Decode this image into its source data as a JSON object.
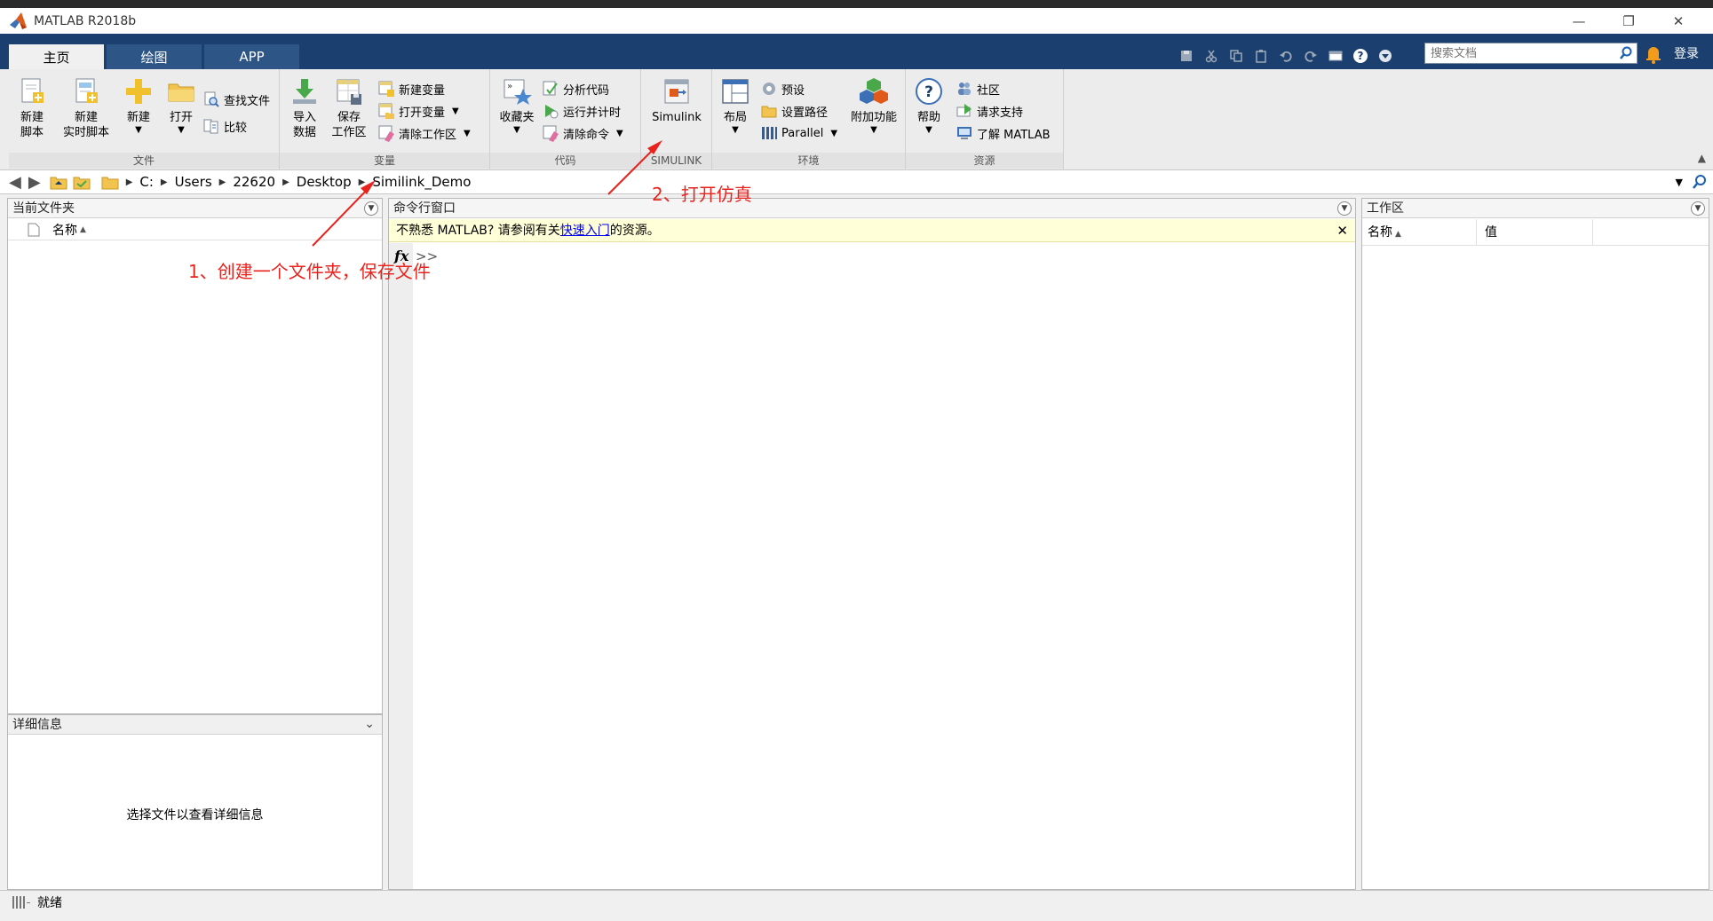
{
  "window": {
    "title": "MATLAB R2018b"
  },
  "tabs": [
    {
      "label": "主页"
    },
    {
      "label": "绘图"
    },
    {
      "label": "APP"
    }
  ],
  "search": {
    "placeholder": "搜索文档"
  },
  "login_label": "登录",
  "ribbon": {
    "file": {
      "label": "文件",
      "new_script": "新建\n脚本",
      "new_live_script": "新建\n实时脚本",
      "new": "新建",
      "open": "打开",
      "find_files": "查找文件",
      "compare": "比较"
    },
    "variable": {
      "label": "变量",
      "import_data": "导入\n数据",
      "save_workspace": "保存\n工作区",
      "new_variable": "新建变量",
      "open_variable": "打开变量",
      "clear_workspace": "清除工作区"
    },
    "code": {
      "label": "代码",
      "favorites": "收藏夹",
      "analyze_code": "分析代码",
      "run_and_time": "运行并计时",
      "clear_commands": "清除命令"
    },
    "simulink": {
      "label": "SIMULINK",
      "simulink": "Simulink"
    },
    "environment": {
      "label": "环境",
      "layout": "布局",
      "preferences": "预设",
      "set_path": "设置路径",
      "parallel": "Parallel",
      "add_ons": "附加功能"
    },
    "resources": {
      "label": "资源",
      "help": "帮助",
      "community": "社区",
      "request_support": "请求支持",
      "learn_matlab": "了解 MATLAB"
    }
  },
  "address": {
    "path": [
      "C:",
      "Users",
      "22620",
      "Desktop",
      "Similink_Demo"
    ]
  },
  "current_folder": {
    "title": "当前文件夹",
    "column_name": "名称"
  },
  "details": {
    "title": "详细信息",
    "message": "选择文件以查看详细信息"
  },
  "command_window": {
    "title": "命令行窗口",
    "notice_prefix": "不熟悉 MATLAB? 请参阅有关",
    "notice_link": "快速入门",
    "notice_suffix": "的资源。",
    "fx": "fx",
    "prompt": ">>"
  },
  "workspace": {
    "title": "工作区",
    "col_name": "名称",
    "col_value": "值"
  },
  "statusbar": {
    "text": "就绪"
  },
  "annotations": {
    "step1": "1、创建一个文件夹，保存文件",
    "step2": "2、打开仿真"
  },
  "colors": {
    "annotation": "#e8231d",
    "tabstrip": "#1b3f6e",
    "link": "#0000ee",
    "notice_bg": "#ffffd8"
  }
}
